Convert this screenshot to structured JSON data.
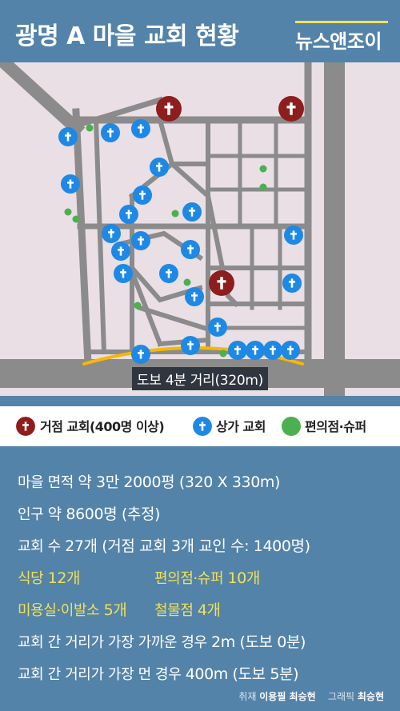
{
  "header": {
    "title": "광명 A 마을 교회 현황",
    "brand": "뉴스앤조이"
  },
  "colors": {
    "background": "#5383a9",
    "map_block": "#e9dfe5",
    "road": "#8b8b8b",
    "large_church": "#8e1d1d",
    "store_church": "#1e88e5",
    "convenience_store": "#4caf50",
    "walk_arc": "#f6b800",
    "highlight_text": "#f2e155"
  },
  "map": {
    "walk_label": "도보 4분 거리(320m)",
    "icons": {
      "large_church": "cross-icon-dark-red",
      "store_church": "cross-icon-blue",
      "convenience_store": "green-dot"
    },
    "counts": {
      "large_church": 3,
      "store_church": 24,
      "convenience_store": 10
    }
  },
  "legend": {
    "large": "거점 교회(400명 이상)",
    "store": "상가 교회",
    "conv": "편의점·슈퍼"
  },
  "stats": {
    "area_label": "마을 면적",
    "area_value": "약 3만 2000평 (320 X 330m)",
    "pop_label": "인구",
    "pop_value": "약 8600명 (추정)",
    "church_label": "교회 수",
    "church_value": "27개 (거점 교회 3개 교인 수: 1400명)",
    "food_label": "식당",
    "food_value": "12개",
    "conv_label": "편의점·슈퍼",
    "conv_value": "10개",
    "beauty_label": "미용실·이발소",
    "beauty_value": "5개",
    "hardware_label": "철물점",
    "hardware_value": "4개",
    "nearest_label": "교회 간 거리가 가장 가까운 경우",
    "nearest_value": "2m (도보 0분)",
    "farthest_label": "교회 간 거리가 가장 먼 경우",
    "farthest_value": "400m (도보 5분)"
  },
  "credits": {
    "report_label": "취재",
    "report_names": "이용필 최승현",
    "graphic_label": "그래픽",
    "graphic_name": "최승현"
  }
}
